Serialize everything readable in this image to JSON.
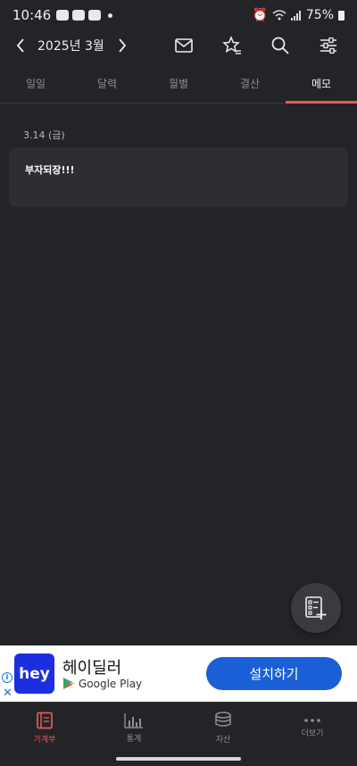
{
  "status_bar": {
    "time": "10:46",
    "battery": "75%"
  },
  "header": {
    "month": "2025년 3월",
    "icons": [
      "chevron-left-icon",
      "chevron-right-icon",
      "mail-icon",
      "star-list-icon",
      "search-icon",
      "filter-sliders-icon"
    ]
  },
  "tabs": [
    {
      "label": "일일",
      "active": false
    },
    {
      "label": "달력",
      "active": false
    },
    {
      "label": "월별",
      "active": false
    },
    {
      "label": "결산",
      "active": false
    },
    {
      "label": "메모",
      "active": true
    }
  ],
  "memos": [
    {
      "date": "3.14 (금)",
      "text": "부자되장!!!"
    }
  ],
  "ad": {
    "logo_text": "hey",
    "title": "헤이딜러",
    "store": "Google Play",
    "cta": "설치하기"
  },
  "bottom_nav": [
    {
      "label": "가계부",
      "icon": "ledger-book-icon",
      "active": true
    },
    {
      "label": "통계",
      "icon": "bar-chart-icon",
      "active": false
    },
    {
      "label": "자산",
      "icon": "coins-icon",
      "active": false
    },
    {
      "label": "더보기",
      "icon": "more-dots-icon",
      "active": false
    }
  ],
  "colors": {
    "accent": "#e8585a",
    "background": "#232427",
    "card": "#2d2e32",
    "ad_button": "#1a5fd6"
  }
}
